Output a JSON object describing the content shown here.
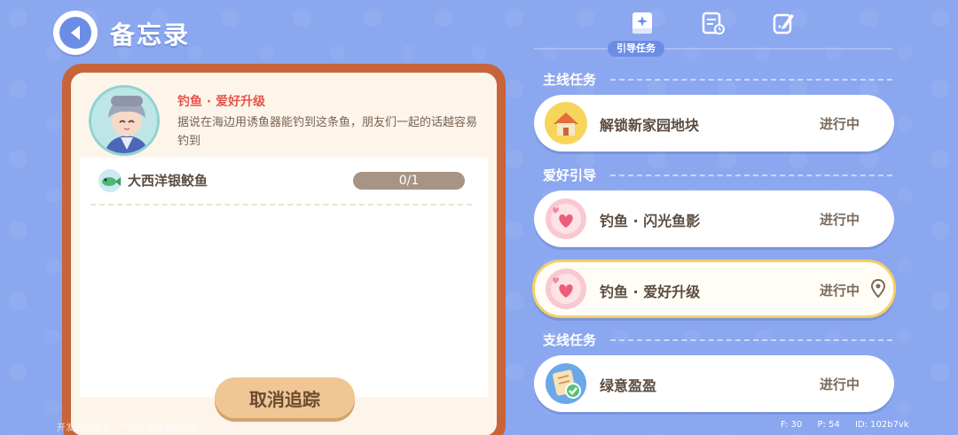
{
  "header": {
    "title": "备忘录",
    "back_icon": "back-arrow-icon"
  },
  "tabs": {
    "active_label": "引导任务",
    "items": [
      {
        "name": "guide-tasks",
        "icon": "task-book-icon"
      },
      {
        "name": "daily-tasks",
        "icon": "clipboard-icon"
      },
      {
        "name": "notes",
        "icon": "note-pencil-icon"
      }
    ]
  },
  "detail": {
    "quest_name": "钓鱼 · 爱好升级",
    "description": "据说在海边用诱鱼器能钓到这条鱼，朋友们一起的话越容易钓到",
    "objective": {
      "label": "大西洋银鲛鱼",
      "progress_text": "0/1",
      "progress_fraction": 0
    },
    "untrack_button": "取消追踪"
  },
  "sections": {
    "main": "主线任务",
    "hobby": "爱好引导",
    "side": "支线任务"
  },
  "tasks": [
    {
      "label": "解锁新家园地块",
      "status": "进行中",
      "icon": "house-icon",
      "selected": false
    },
    {
      "label": "钓鱼 · 闪光鱼影",
      "status": "进行中",
      "icon": "heart-bubble-icon",
      "selected": false
    },
    {
      "label": "钓鱼 · 爱好升级",
      "status": "进行中",
      "icon": "heart-bubble-icon",
      "selected": true
    },
    {
      "label": "绿意盈盈",
      "status": "进行中",
      "icon": "checklist-icon",
      "selected": false
    }
  ],
  "footer": {
    "watermark": "开发测试版本，不代表游戏最终品质",
    "fps": "F: 30",
    "ping": "P: 54",
    "id": "ID: 102b7vk"
  },
  "colors": {
    "background": "#8ba7ef",
    "frame": "#c7643a",
    "accent_red": "#e8534a",
    "selected_border": "#f3cf67"
  }
}
